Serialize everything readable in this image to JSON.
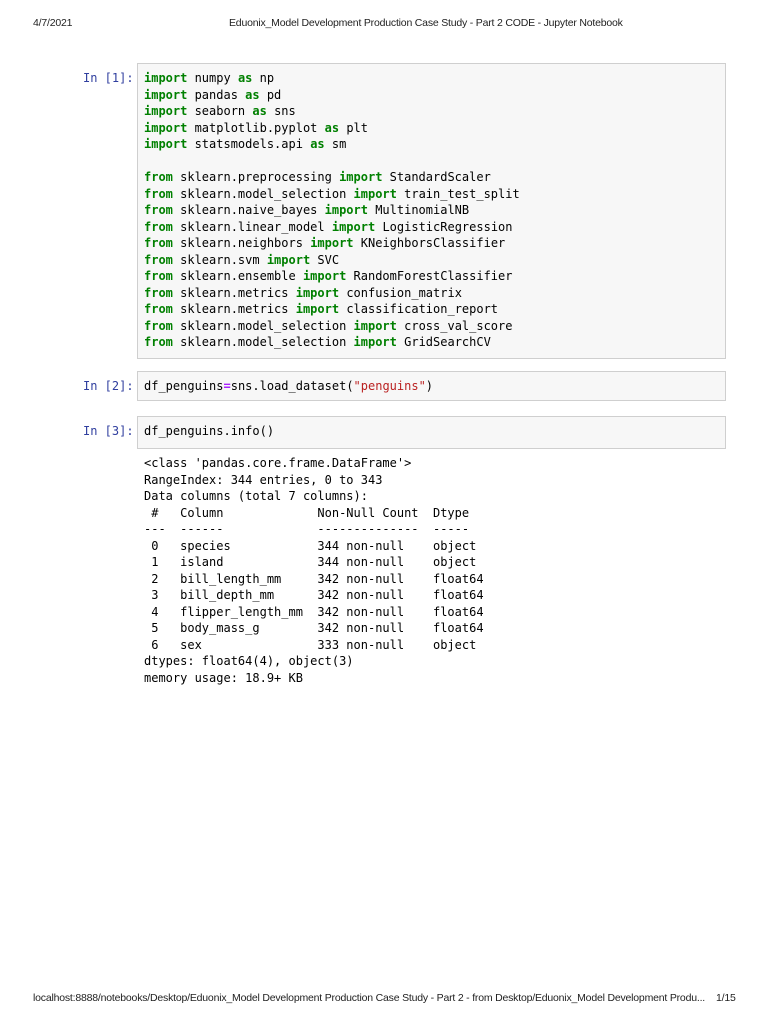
{
  "page_header": {
    "date": "4/7/2021",
    "title": "Eduonix_Model Development Production Case Study - Part 2 CODE - Jupyter Notebook"
  },
  "page_footer": {
    "url": "localhost:8888/notebooks/Desktop/Eduonix_Model Development Production Case Study - Part 2 - from Desktop/Eduonix_Model Development Produ...",
    "page": "1/15"
  },
  "colors": {
    "prompt": "#303F9F",
    "keyword": "#008000",
    "operator": "#AA22FF",
    "string": "#BA2121"
  },
  "cells": [
    {
      "prompt": "In [1]:",
      "lines": [
        [
          [
            "kw",
            "import"
          ],
          [
            "p",
            " numpy "
          ],
          [
            "kw",
            "as"
          ],
          [
            "p",
            " np"
          ]
        ],
        [
          [
            "kw",
            "import"
          ],
          [
            "p",
            " pandas "
          ],
          [
            "kw",
            "as"
          ],
          [
            "p",
            " pd"
          ]
        ],
        [
          [
            "kw",
            "import"
          ],
          [
            "p",
            " seaborn "
          ],
          [
            "kw",
            "as"
          ],
          [
            "p",
            " sns"
          ]
        ],
        [
          [
            "kw",
            "import"
          ],
          [
            "p",
            " matplotlib.pyplot "
          ],
          [
            "kw",
            "as"
          ],
          [
            "p",
            " plt"
          ]
        ],
        [
          [
            "kw",
            "import"
          ],
          [
            "p",
            " statsmodels.api "
          ],
          [
            "kw",
            "as"
          ],
          [
            "p",
            " sm"
          ]
        ],
        [],
        [
          [
            "kw",
            "from"
          ],
          [
            "p",
            " sklearn.preprocessing "
          ],
          [
            "kw",
            "import"
          ],
          [
            "p",
            " StandardScaler"
          ]
        ],
        [
          [
            "kw",
            "from"
          ],
          [
            "p",
            " sklearn.model_selection "
          ],
          [
            "kw",
            "import"
          ],
          [
            "p",
            " train_test_split"
          ]
        ],
        [
          [
            "kw",
            "from"
          ],
          [
            "p",
            " sklearn.naive_bayes "
          ],
          [
            "kw",
            "import"
          ],
          [
            "p",
            " MultinomialNB"
          ]
        ],
        [
          [
            "kw",
            "from"
          ],
          [
            "p",
            " sklearn.linear_model "
          ],
          [
            "kw",
            "import"
          ],
          [
            "p",
            " LogisticRegression"
          ]
        ],
        [
          [
            "kw",
            "from"
          ],
          [
            "p",
            " sklearn.neighbors "
          ],
          [
            "kw",
            "import"
          ],
          [
            "p",
            " KNeighborsClassifier"
          ]
        ],
        [
          [
            "kw",
            "from"
          ],
          [
            "p",
            " sklearn.svm "
          ],
          [
            "kw",
            "import"
          ],
          [
            "p",
            " SVC"
          ]
        ],
        [
          [
            "kw",
            "from"
          ],
          [
            "p",
            " sklearn.ensemble "
          ],
          [
            "kw",
            "import"
          ],
          [
            "p",
            " RandomForestClassifier"
          ]
        ],
        [
          [
            "kw",
            "from"
          ],
          [
            "p",
            " sklearn.metrics "
          ],
          [
            "kw",
            "import"
          ],
          [
            "p",
            " confusion_matrix"
          ]
        ],
        [
          [
            "kw",
            "from"
          ],
          [
            "p",
            " sklearn.metrics "
          ],
          [
            "kw",
            "import"
          ],
          [
            "p",
            " classification_report"
          ]
        ],
        [
          [
            "kw",
            "from"
          ],
          [
            "p",
            " sklearn.model_selection "
          ],
          [
            "kw",
            "import"
          ],
          [
            "p",
            " cross_val_score"
          ]
        ],
        [
          [
            "kw",
            "from"
          ],
          [
            "p",
            " sklearn.model_selection "
          ],
          [
            "kw",
            "import"
          ],
          [
            "p",
            " GridSearchCV"
          ]
        ]
      ]
    },
    {
      "prompt": "In [2]:",
      "lines": [
        [
          [
            "p",
            "df_penguins"
          ],
          [
            "op",
            "="
          ],
          [
            "p",
            "sns.load_dataset("
          ],
          [
            "str",
            "\"penguins\""
          ],
          [
            "p",
            ")"
          ]
        ]
      ]
    },
    {
      "prompt": "In [3]:",
      "lines": [
        [
          [
            "p",
            "df_penguins.info()"
          ]
        ]
      ],
      "output": [
        "<class 'pandas.core.frame.DataFrame'>",
        "RangeIndex: 344 entries, 0 to 343",
        "Data columns (total 7 columns):",
        " #   Column             Non-Null Count  Dtype  ",
        "---  ------             --------------  -----  ",
        " 0   species            344 non-null    object ",
        " 1   island             344 non-null    object ",
        " 2   bill_length_mm     342 non-null    float64",
        " 3   bill_depth_mm      342 non-null    float64",
        " 4   flipper_length_mm  342 non-null    float64",
        " 5   body_mass_g        342 non-null    float64",
        " 6   sex                333 non-null    object ",
        "dtypes: float64(4), object(3)",
        "memory usage: 18.9+ KB"
      ]
    }
  ]
}
